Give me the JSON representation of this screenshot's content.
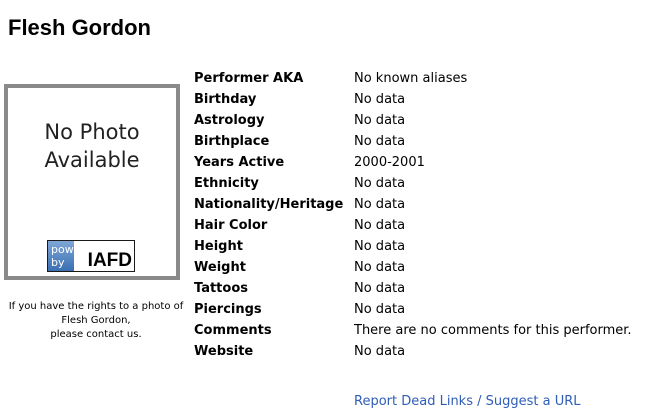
{
  "performer": {
    "name": "Flesh Gordon"
  },
  "photo": {
    "placeholder_line1": "No Photo",
    "placeholder_line2": "Available",
    "badge_powered": "powered",
    "badge_by": "by",
    "badge_brand": "IAFD"
  },
  "rights_note": {
    "line1": "If you have the rights to a photo of",
    "line2": "Flesh Gordon,",
    "line3": "please contact us."
  },
  "details": [
    {
      "label": "Performer AKA",
      "value": "No known aliases"
    },
    {
      "label": "Birthday",
      "value": "No data"
    },
    {
      "label": "Astrology",
      "value": "No data"
    },
    {
      "label": "Birthplace",
      "value": "No data"
    },
    {
      "label": "Years Active",
      "value": "2000-2001"
    },
    {
      "label": "Ethnicity",
      "value": "No data"
    },
    {
      "label": "Nationality/Heritage",
      "value": "No data"
    },
    {
      "label": "Hair Color",
      "value": "No data"
    },
    {
      "label": "Height",
      "value": "No data"
    },
    {
      "label": "Weight",
      "value": "No data"
    },
    {
      "label": "Tattoos",
      "value": "No data"
    },
    {
      "label": "Piercings",
      "value": "No data"
    },
    {
      "label": "Comments",
      "value": "There are no comments for this performer."
    },
    {
      "label": "Website",
      "value": "No data"
    }
  ],
  "footer": {
    "report_link": "Report Dead Links / Suggest a URL"
  },
  "colors": {
    "link": "#2f5db8",
    "photo_border": "#8a8a8a",
    "badge_blue": "#3a6fb3"
  }
}
